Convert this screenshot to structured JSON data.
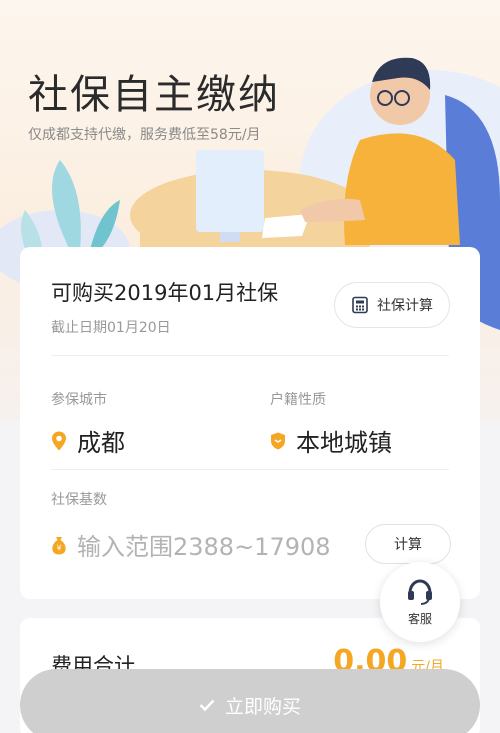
{
  "hero": {
    "title": "社保自主缴纳",
    "subtitle": "仅成都支持代缴，服务费低至58元/月"
  },
  "period_card": {
    "title": "可购买2019年01月社保",
    "deadline": "截止日期01月20日",
    "calc_link_label": "社保计算",
    "city_label": "参保城市",
    "city_value": "成都",
    "hukou_label": "户籍性质",
    "hukou_value": "本地城镇",
    "base_label": "社保基数",
    "base_placeholder": "输入范围2388~17908",
    "calc_button_label": "计算"
  },
  "total_card": {
    "label": "费用合计",
    "amount": "0.00",
    "unit": "元/月"
  },
  "customer_service": {
    "label": "客服"
  },
  "buy_button": {
    "label": "立即购买"
  },
  "colors": {
    "accent": "#f5a623",
    "buy_disabled": "#cfcfcf",
    "placeholder": "#b3b3b3"
  }
}
